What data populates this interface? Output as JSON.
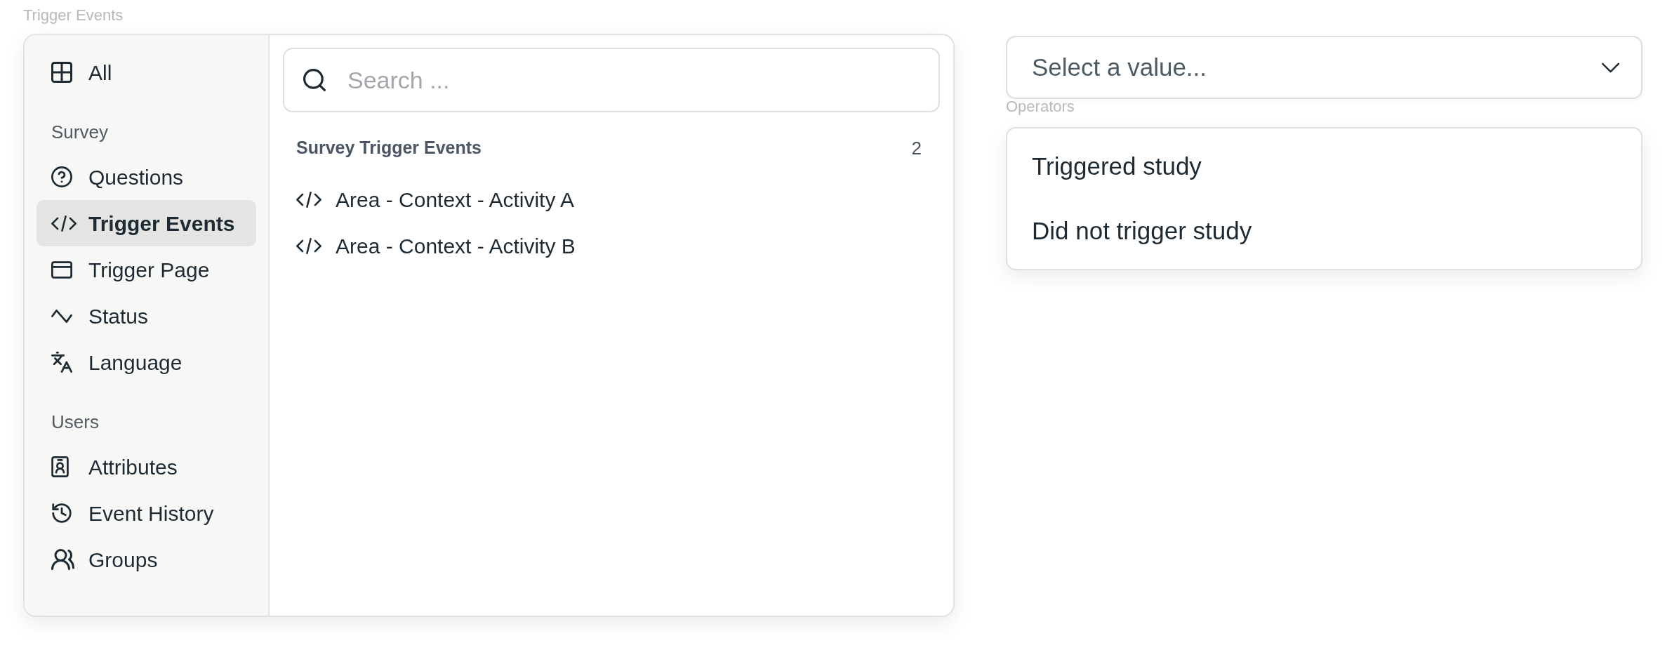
{
  "field_label": "Trigger Events",
  "sidebar": {
    "items": [
      {
        "label": "All",
        "selected": false
      }
    ],
    "sections": [
      {
        "heading": "Survey",
        "items": [
          {
            "label": "Questions",
            "selected": false
          },
          {
            "label": "Trigger Events",
            "selected": true
          },
          {
            "label": "Trigger Page",
            "selected": false
          },
          {
            "label": "Status",
            "selected": false
          },
          {
            "label": "Language",
            "selected": false
          }
        ]
      },
      {
        "heading": "Users",
        "items": [
          {
            "label": "Attributes",
            "selected": false
          },
          {
            "label": "Event History",
            "selected": false
          },
          {
            "label": "Groups",
            "selected": false
          }
        ]
      }
    ]
  },
  "search": {
    "placeholder": "Search ..."
  },
  "results": {
    "heading": "Survey Trigger Events",
    "count": "2",
    "items": [
      {
        "label": "Area - Context - Activity A",
        "selected": false
      },
      {
        "label": "Area - Context - Activity B",
        "selected": false
      }
    ]
  },
  "value_select": {
    "placeholder": "Select a value..."
  },
  "operators": {
    "label": "Operators",
    "options": [
      {
        "label": "Triggered study",
        "selected": false
      },
      {
        "label": "Did not trigger study",
        "selected": false
      }
    ]
  }
}
